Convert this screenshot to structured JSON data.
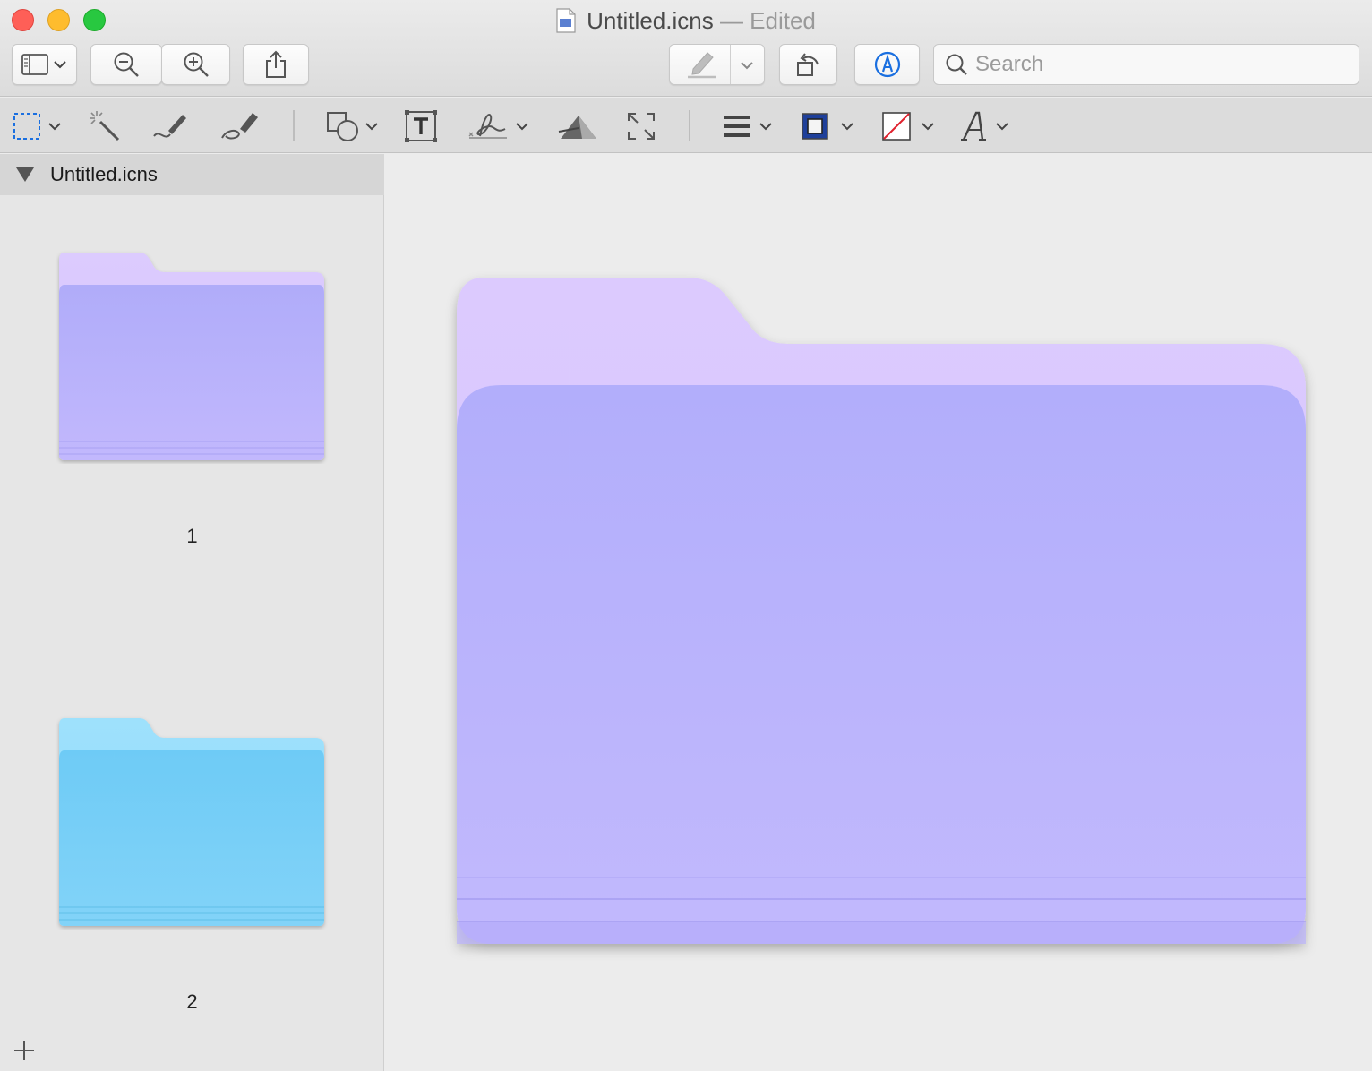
{
  "window": {
    "title": "Untitled.icns",
    "title_suffix": " — Edited"
  },
  "toolbar": {
    "search_placeholder": "Search",
    "icons": [
      "sidebar-view-icon",
      "chevron-down-icon",
      "zoom-out-icon",
      "zoom-in-icon",
      "share-icon",
      "highlight-icon",
      "chevron-down-icon",
      "rotate-icon",
      "markup-icon",
      "search-icon"
    ]
  },
  "markup_toolbar": {
    "icons": [
      "rect-selection-icon",
      "instant-alpha-icon",
      "sketch-icon",
      "draw-icon",
      "shapes-icon",
      "text-icon",
      "sign-icon",
      "adjust-color-icon",
      "adjust-size-icon",
      "line-style-icon",
      "border-color-icon",
      "fill-color-icon",
      "text-style-icon"
    ],
    "border_color": "#1e3f9a",
    "fill_color": "none"
  },
  "sidebar": {
    "header": "Untitled.icns",
    "thumbnails": [
      {
        "label": "1",
        "color": "#b6b0fb"
      },
      {
        "label": "2",
        "color": "#72cdf7"
      }
    ]
  },
  "main": {
    "folder_color": "#b6b1fc",
    "folder_tab_color": "#d9c6fe"
  },
  "colors": {
    "close": "#fe5f57",
    "minimize": "#febc2e",
    "maximize": "#28c840",
    "accent": "#1a6fe0"
  }
}
